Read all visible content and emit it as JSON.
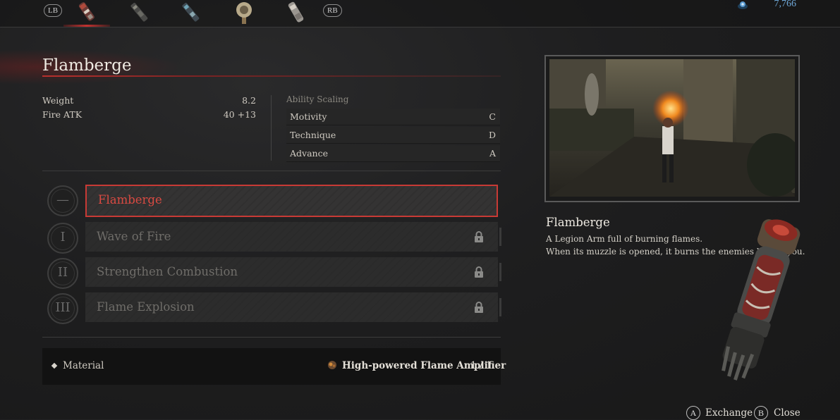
{
  "topbar": {
    "left_bumper": "LB",
    "right_bumper": "RB",
    "weapons": [
      "flamberge-arm-icon",
      "legion-arm-2-icon",
      "legion-arm-3-icon",
      "legion-arm-4-icon",
      "legion-arm-5-icon"
    ],
    "currency": "7,766"
  },
  "header": {
    "title": "Flamberge"
  },
  "stats": [
    {
      "label": "Weight",
      "value": "8.2"
    },
    {
      "label": "Fire ATK",
      "value": "40 +13"
    }
  ],
  "ability_scaling": {
    "label": "Ability Scaling",
    "rows": [
      {
        "name": "Motivity",
        "grade": "C"
      },
      {
        "name": "Technique",
        "grade": "D"
      },
      {
        "name": "Advance",
        "grade": "A"
      }
    ]
  },
  "skills": [
    {
      "tier": "—",
      "name": "Flamberge",
      "locked": false
    },
    {
      "tier": "I",
      "name": "Wave of Fire",
      "locked": true
    },
    {
      "tier": "II",
      "name": "Strengthen Combustion",
      "locked": true
    },
    {
      "tier": "III",
      "name": "Flame Explosion",
      "locked": true
    }
  ],
  "material": {
    "label": "Material",
    "item": "High-powered Flame Amplifier",
    "count": "1 / 1"
  },
  "description": {
    "title": "Flamberge",
    "lines": [
      "A Legion Arm full of burning flames.",
      "When its muzzle is opened, it burns the enemies before you."
    ]
  },
  "footer": {
    "exchange_key": "A",
    "exchange_label": "Exchange",
    "close_key": "B",
    "close_label": "Close"
  },
  "colors": {
    "accent": "#c83a35",
    "currency": "#6fa8d8"
  }
}
